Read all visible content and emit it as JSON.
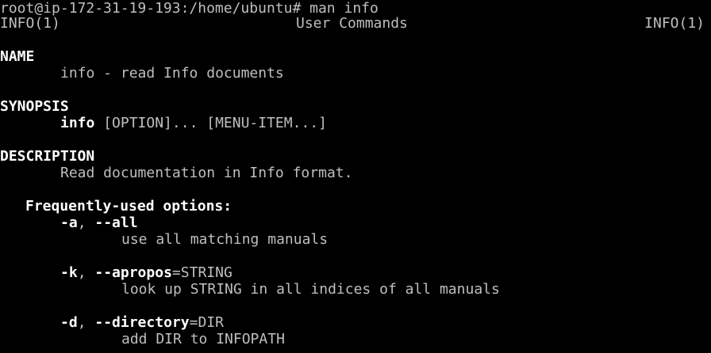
{
  "prompt": {
    "text": "root@ip-172-31-19-193:/home/ubuntu# man info"
  },
  "header": {
    "left": "INFO(1)",
    "center": "User Commands",
    "right": "INFO(1)"
  },
  "sections": {
    "name": {
      "heading": "NAME",
      "text": "info - read Info documents"
    },
    "synopsis": {
      "heading": "SYNOPSIS",
      "command": "info",
      "args": " [OPTION]... [MENU-ITEM...]"
    },
    "description": {
      "heading": "DESCRIPTION",
      "text": "Read documentation in Info format."
    }
  },
  "options_heading": "Frequently-used options:",
  "options": [
    {
      "short": "-a",
      "sep": ", ",
      "long": "--all",
      "arg_sep": "",
      "arg": "",
      "desc": "use all matching manuals"
    },
    {
      "short": "-k",
      "sep": ", ",
      "long": "--apropos",
      "arg_sep": "=",
      "arg": "STRING",
      "desc": "look up STRING in all indices of all manuals"
    },
    {
      "short": "-d",
      "sep": ", ",
      "long": "--directory",
      "arg_sep": "=",
      "arg": "DIR",
      "desc": "add DIR to INFOPATH"
    }
  ],
  "colors": {
    "background": "#000000",
    "text": "#bfbfbf",
    "bold": "#ffffff"
  }
}
